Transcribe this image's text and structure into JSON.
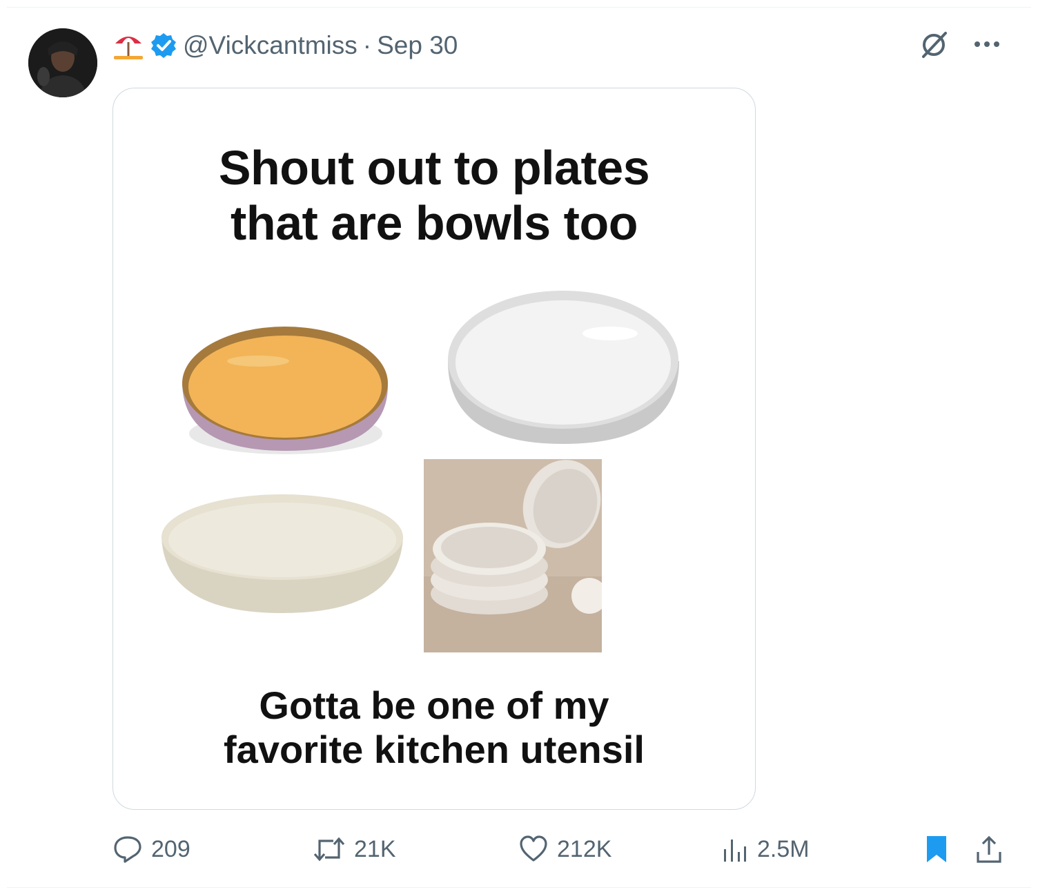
{
  "post": {
    "handle": "@Vickcantmiss",
    "separator": "·",
    "date": "Sep 30",
    "header_icons": [
      "beach-umbrella-emoji",
      "verified-badge-icon"
    ]
  },
  "media": {
    "caption_top_line1": "Shout out to plates",
    "caption_top_line2": "that are bowls too",
    "caption_bottom_line1": "Gotta be one of my",
    "caption_bottom_line2": "favorite kitchen utensil"
  },
  "actions": {
    "replies": "209",
    "reposts": "21K",
    "likes": "212K",
    "views": "2.5M"
  },
  "colors": {
    "text_secondary": "#536471",
    "accent": "#1d9bf0",
    "border": "#cfd9de"
  }
}
